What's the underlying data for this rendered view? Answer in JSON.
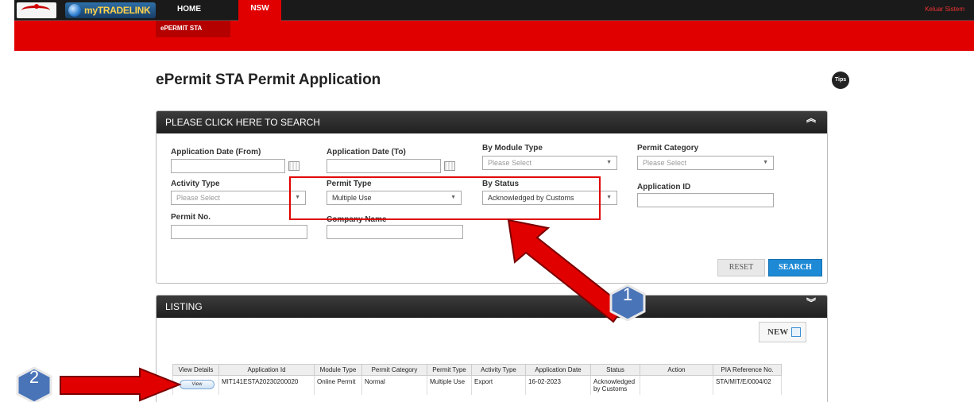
{
  "header": {
    "gov_logo": "malaysia-gov-logo",
    "brand": "myTRADELINK",
    "nav": [
      "HOME",
      "NSW"
    ],
    "user_link": "Keluar Sistem",
    "subtab": "ePERMIT STA"
  },
  "page": {
    "title": "ePermit STA Permit Application",
    "tips_label": "Tips"
  },
  "search": {
    "header": "PLEASE CLICK HERE TO SEARCH",
    "fields": {
      "date_from_label": "Application Date (From)",
      "date_to_label": "Application Date (To)",
      "module_type_label": "By Module Type",
      "module_type_value": "Please Select",
      "permit_category_label": "Permit Category",
      "permit_category_value": "Please Select",
      "activity_type_label": "Activity Type",
      "activity_type_value": "Please Select",
      "permit_type_label": "Permit Type",
      "permit_type_value": "Multiple Use",
      "status_label": "By Status",
      "status_value": "Acknowledged by Customs",
      "app_id_label": "Application ID",
      "permit_no_label": "Permit No.",
      "company_label": "Company Name"
    },
    "reset_label": "RESET",
    "search_label": "SEARCH"
  },
  "listing": {
    "header": "LISTING",
    "new_label": "NEW",
    "columns": [
      "View Details",
      "Application Id",
      "Module Type",
      "Permit Category",
      "Permit Type",
      "Activity Type",
      "Application Date",
      "Status",
      "Action",
      "PIA Reference No."
    ],
    "rows": [
      {
        "view": "View",
        "application_id": "MIT141ESTA20230200020",
        "module_type": "Online Permit",
        "permit_category": "Normal",
        "permit_type": "Multiple Use",
        "activity_type": "Export",
        "application_date": "16-02-2023",
        "status": "Acknowledged by Customs",
        "action": "",
        "pia_ref": "STA/MIT/E/0004/02"
      }
    ]
  },
  "annotations": {
    "badge_1": "1",
    "badge_2": "2",
    "arrow_color": "#e00000",
    "badge_color": "#4a74b8"
  }
}
